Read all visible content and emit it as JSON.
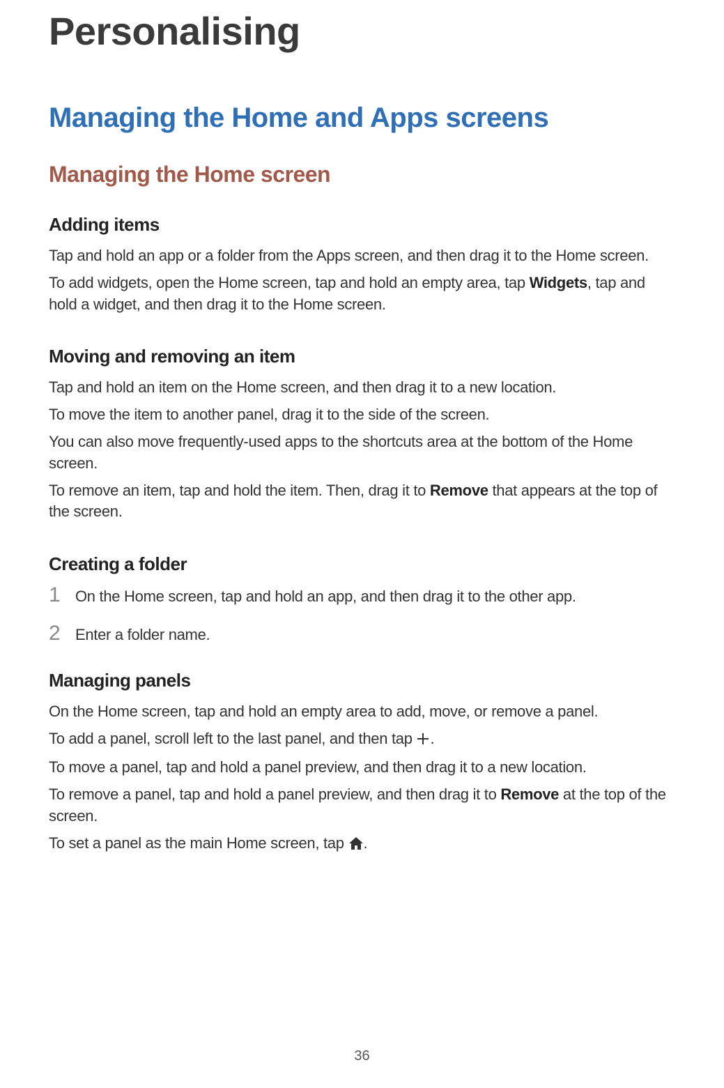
{
  "title": "Personalising",
  "h2": "Managing the Home and Apps screens",
  "h3": "Managing the Home screen",
  "adding": {
    "heading": "Adding items",
    "p1": "Tap and hold an app or a folder from the Apps screen, and then drag it to the Home screen.",
    "p2a": "To add widgets, open the Home screen, tap and hold an empty area, tap ",
    "p2b": "Widgets",
    "p2c": ", tap and hold a widget, and then drag it to the Home screen."
  },
  "moving": {
    "heading": "Moving and removing an item",
    "p1": "Tap and hold an item on the Home screen, and then drag it to a new location.",
    "p2": "To move the item to another panel, drag it to the side of the screen.",
    "p3": "You can also move frequently-used apps to the shortcuts area at the bottom of the Home screen.",
    "p4a": "To remove an item, tap and hold the item. Then, drag it to ",
    "p4b": "Remove",
    "p4c": " that appears at the top of the screen."
  },
  "folder": {
    "heading": "Creating a folder",
    "step1num": "1",
    "step1": "On the Home screen, tap and hold an app, and then drag it to the other app.",
    "step2num": "2",
    "step2": "Enter a folder name."
  },
  "panels": {
    "heading": "Managing panels",
    "p1": "On the Home screen, tap and hold an empty area to add, move, or remove a panel.",
    "p2a": "To add a panel, scroll left to the last panel, and then tap ",
    "p2b": ".",
    "p3": "To move a panel, tap and hold a panel preview, and then drag it to a new location.",
    "p4a": "To remove a panel, tap and hold a panel preview, and then drag it to ",
    "p4b": "Remove",
    "p4c": " at the top of the screen.",
    "p5a": "To set a panel as the main Home screen, tap ",
    "p5b": "."
  },
  "pageNumber": "36"
}
